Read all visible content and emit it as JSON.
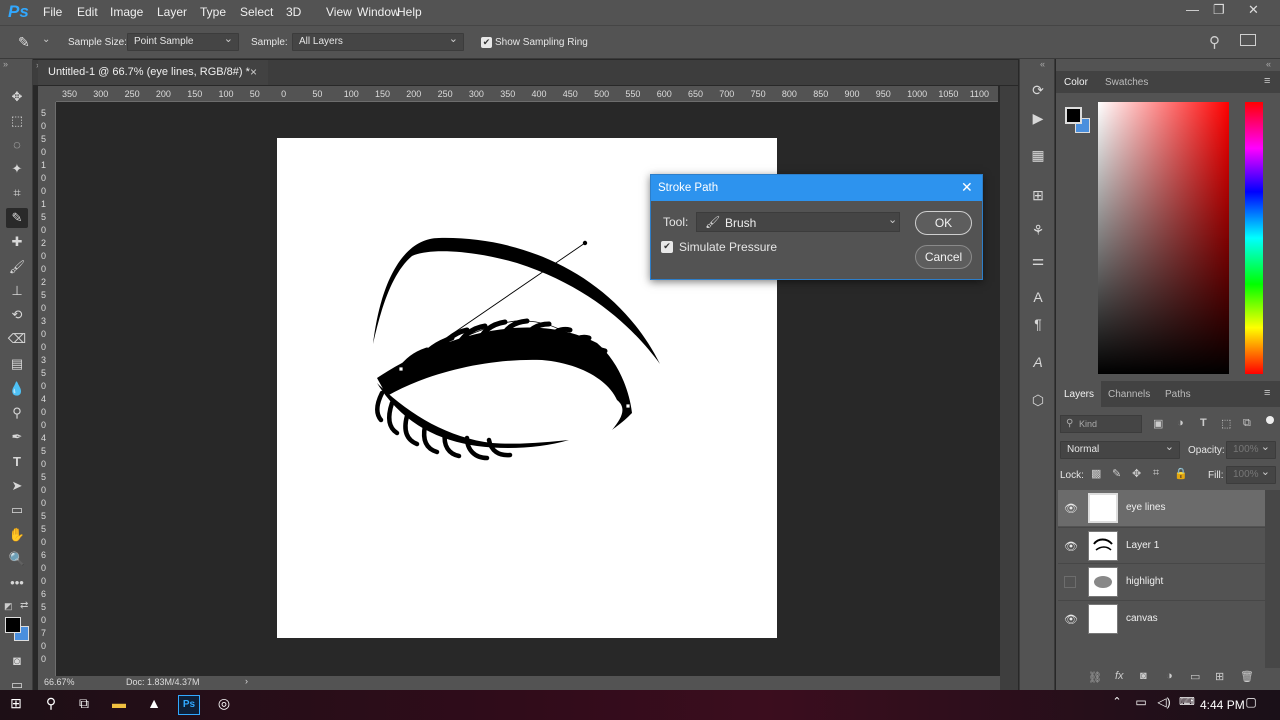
{
  "app": {
    "logo": "Ps"
  },
  "menu": [
    "File",
    "Edit",
    "Image",
    "Layer",
    "Type",
    "Select",
    "3D",
    "View",
    "Window",
    "Help"
  ],
  "window_controls": {
    "minimize": "—",
    "restore": "❐",
    "close": "✕"
  },
  "options": {
    "sample_size_label": "Sample Size:",
    "sample_size_value": "Point Sample",
    "sample_label": "Sample:",
    "sample_value": "All Layers",
    "show_ring_label": "Show Sampling Ring",
    "show_ring_checked": true
  },
  "document": {
    "tab_title": "Untitled-1 @ 66.7% (eye lines, RGB/8#) *",
    "close": "×"
  },
  "ruler_h": [
    "350",
    "300",
    "250",
    "200",
    "150",
    "100",
    "50",
    "0",
    "50",
    "100",
    "150",
    "200",
    "250",
    "300",
    "350",
    "400",
    "450",
    "500",
    "550",
    "600",
    "650",
    "700",
    "750",
    "800",
    "850",
    "900",
    "950",
    "1000",
    "1050",
    "1100"
  ],
  "ruler_v": [
    "5",
    "0",
    "5",
    "0",
    "1",
    "0",
    "0",
    "1",
    "5",
    "0",
    "2",
    "0",
    "0",
    "2",
    "5",
    "0",
    "3",
    "0",
    "0",
    "3",
    "5",
    "0",
    "4",
    "0",
    "0",
    "4",
    "5",
    "0",
    "5",
    "0",
    "0",
    "5",
    "5",
    "0",
    "6",
    "0",
    "0",
    "6",
    "5",
    "0",
    "7",
    "0",
    "0"
  ],
  "status": {
    "zoom": "66.67%",
    "doc": "Doc: 1.83M/4.37M",
    "arrow": "›"
  },
  "dialog": {
    "title": "Stroke Path",
    "tool_label": "Tool:",
    "tool_value": "Brush",
    "simulate_label": "Simulate Pressure",
    "simulate_checked": true,
    "ok": "OK",
    "cancel": "Cancel"
  },
  "color_panel": {
    "tabs": [
      "Color",
      "Swatches"
    ],
    "foreground": "#000000",
    "background": "#4a8fdd"
  },
  "layers_panel": {
    "tabs": [
      "Layers",
      "Channels",
      "Paths"
    ],
    "kind_placeholder": "Kind",
    "blend_mode": "Normal",
    "opacity_label": "Opacity:",
    "opacity_value": "100%",
    "lock_label": "Lock:",
    "fill_label": "Fill:",
    "fill_value": "100%",
    "layers": [
      {
        "name": "eye lines",
        "visible": true,
        "selected": true,
        "thumb": "transparent"
      },
      {
        "name": "Layer 1",
        "visible": true,
        "selected": false,
        "thumb": "brow"
      },
      {
        "name": "highlight",
        "visible": false,
        "selected": false,
        "thumb": "blob"
      },
      {
        "name": "canvas",
        "visible": true,
        "selected": false,
        "thumb": "white"
      }
    ]
  },
  "taskbar": {
    "time": "4:44 PM"
  },
  "colors": {
    "accent": "#2d93ee",
    "panel": "#535353",
    "workspace": "#282828"
  }
}
